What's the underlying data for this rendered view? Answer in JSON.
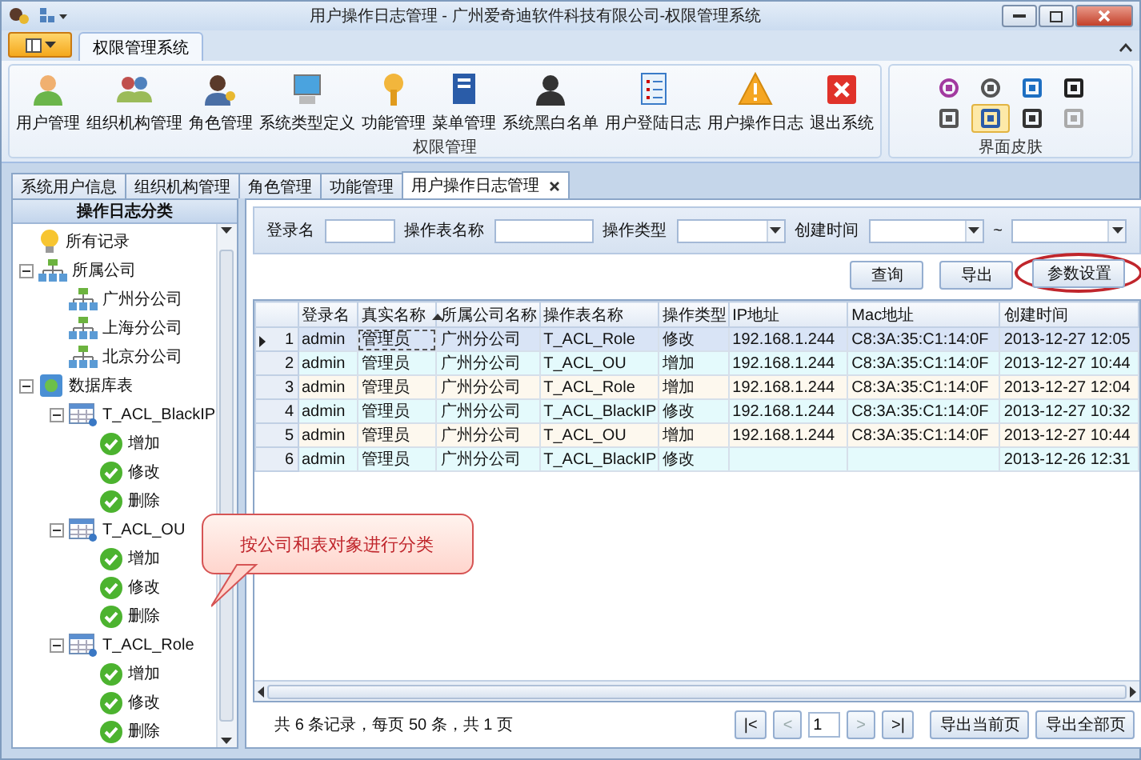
{
  "window": {
    "title": "用户操作日志管理 - 广州爱奇迪软件科技有限公司-权限管理系统"
  },
  "ribbon": {
    "tabs": [
      {
        "label": "权限管理系统",
        "selected": true
      }
    ],
    "groups": [
      {
        "label": "权限管理",
        "items": [
          "用户管理",
          "组织机构管理",
          "角色管理",
          "系统类型定义",
          "功能管理",
          "菜单管理",
          "系统黑白名单",
          "用户登陆日志",
          "用户操作日志",
          "退出系统"
        ]
      }
    ],
    "skins": {
      "label": "界面皮肤",
      "items": [
        {
          "selected": false
        },
        {
          "selected": false
        },
        {
          "selected": false
        },
        {
          "selected": false
        },
        {
          "selected": false
        },
        {
          "selected": true
        },
        {
          "selected": false
        },
        {
          "selected": false
        }
      ]
    }
  },
  "doc_tabs": [
    {
      "label": "系统用户信息",
      "selected": false
    },
    {
      "label": "组织机构管理",
      "selected": false
    },
    {
      "label": "角色管理",
      "selected": false
    },
    {
      "label": "功能管理",
      "selected": false
    },
    {
      "label": "用户操作日志管理",
      "selected": true
    }
  ],
  "left_panel": {
    "title": "操作日志分类",
    "tree": [
      {
        "label": "所有记录",
        "kind": "bulb"
      },
      {
        "label": "所属公司",
        "kind": "org",
        "expanded": true,
        "children": [
          {
            "label": "广州分公司",
            "kind": "org"
          },
          {
            "label": "上海分公司",
            "kind": "org"
          },
          {
            "label": "北京分公司",
            "kind": "org"
          }
        ]
      },
      {
        "label": "数据库表",
        "kind": "database",
        "expanded": true,
        "children": [
          {
            "label": "T_ACL_BlackIP",
            "kind": "table",
            "expanded": true,
            "children": [
              {
                "label": "增加",
                "kind": "check"
              },
              {
                "label": "修改",
                "kind": "check"
              },
              {
                "label": "删除",
                "kind": "check"
              }
            ]
          },
          {
            "label": "T_ACL_OU",
            "kind": "table",
            "expanded": true,
            "children": [
              {
                "label": "增加",
                "kind": "check"
              },
              {
                "label": "修改",
                "kind": "check"
              },
              {
                "label": "删除",
                "kind": "check"
              }
            ]
          },
          {
            "label": "T_ACL_Role",
            "kind": "table",
            "expanded": true,
            "children": [
              {
                "label": "增加",
                "kind": "check"
              },
              {
                "label": "修改",
                "kind": "check"
              },
              {
                "label": "删除",
                "kind": "check"
              }
            ]
          }
        ]
      }
    ]
  },
  "filters": [
    {
      "label": "登录名",
      "kind": "text"
    },
    {
      "label": "操作表名称",
      "kind": "text"
    },
    {
      "label": "操作类型",
      "kind": "select"
    },
    {
      "label": "创建时间",
      "kind": "daterange",
      "separator": "~"
    }
  ],
  "buttons": [
    {
      "label": "查询",
      "highlighted": false
    },
    {
      "label": "导出",
      "highlighted": false
    },
    {
      "label": "参数设置",
      "highlighted": true
    }
  ],
  "grid": {
    "columns": [
      {
        "label": "登录名",
        "sorted": false
      },
      {
        "label": "真实名称",
        "sorted": true
      },
      {
        "label": "所属公司名称",
        "sorted": false
      },
      {
        "label": "操作表名称",
        "sorted": false
      },
      {
        "label": "操作类型",
        "sorted": false
      },
      {
        "label": "IP地址",
        "sorted": false
      },
      {
        "label": "Mac地址",
        "sorted": false
      },
      {
        "label": "创建时间",
        "sorted": false
      }
    ],
    "rows": [
      {
        "number": "1",
        "selected": true,
        "cells": [
          "admin",
          "管理员",
          "广州分公司",
          "T_ACL_Role",
          "修改",
          "192.168.1.244",
          "C8:3A:35:C1:14:0F",
          "2013-12-27 12:05"
        ]
      },
      {
        "number": "2",
        "selected": false,
        "cells": [
          "admin",
          "管理员",
          "广州分公司",
          "T_ACL_OU",
          "增加",
          "192.168.1.244",
          "C8:3A:35:C1:14:0F",
          "2013-12-27 10:44"
        ]
      },
      {
        "number": "3",
        "selected": false,
        "cells": [
          "admin",
          "管理员",
          "广州分公司",
          "T_ACL_Role",
          "增加",
          "192.168.1.244",
          "C8:3A:35:C1:14:0F",
          "2013-12-27 12:04"
        ]
      },
      {
        "number": "4",
        "selected": false,
        "cells": [
          "admin",
          "管理员",
          "广州分公司",
          "T_ACL_BlackIP",
          "修改",
          "192.168.1.244",
          "C8:3A:35:C1:14:0F",
          "2013-12-27 10:32"
        ]
      },
      {
        "number": "5",
        "selected": false,
        "cells": [
          "admin",
          "管理员",
          "广州分公司",
          "T_ACL_OU",
          "增加",
          "192.168.1.244",
          "C8:3A:35:C1:14:0F",
          "2013-12-27 10:44"
        ]
      },
      {
        "number": "6",
        "selected": false,
        "cells": [
          "admin",
          "管理员",
          "广州分公司",
          "T_ACL_BlackIP",
          "修改",
          "",
          "",
          "2013-12-26 12:31"
        ]
      }
    ]
  },
  "pager": {
    "summary": "共 6 条记录，每页 50 条，共 1 页",
    "page": "1",
    "nav": [
      {
        "label": "|<",
        "disabled": false
      },
      {
        "label": "<",
        "disabled": true
      },
      {
        "label": ">",
        "disabled": true
      },
      {
        "label": ">|",
        "disabled": false
      }
    ],
    "exports": [
      "导出当前页",
      "导出全部页"
    ]
  },
  "callout": {
    "text": "按公司和表对象进行分类"
  }
}
